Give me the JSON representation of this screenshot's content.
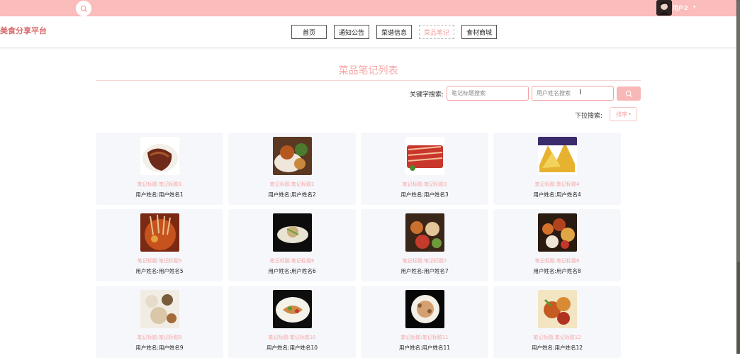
{
  "topbar": {
    "username": "用户2",
    "caret": "▾"
  },
  "brand": {
    "logo": "美食分享平台"
  },
  "nav": {
    "items": [
      {
        "label": "首页"
      },
      {
        "label": "通知公告"
      },
      {
        "label": "菜谱信息"
      },
      {
        "label": "菜品笔记"
      },
      {
        "label": "食材商城"
      }
    ],
    "active": "菜品笔记"
  },
  "main": {
    "title": "菜品笔记列表",
    "search": {
      "keyword_label": "关键字搜索:",
      "title_placeholder": "笔记标题搜索",
      "user_placeholder": "用户姓名搜索"
    },
    "dropdown": {
      "label": "下拉搜索:",
      "selected": "排序"
    }
  },
  "cards": [
    {
      "title": "笔记标题:笔记标题1",
      "user": "用户姓名:用户姓名1"
    },
    {
      "title": "笔记标题:笔记标题2",
      "user": "用户姓名:用户姓名2"
    },
    {
      "title": "笔记标题:笔记标题3",
      "user": "用户姓名:用户姓名3"
    },
    {
      "title": "笔记标题:笔记标题4",
      "user": "用户姓名:用户姓名4"
    },
    {
      "title": "笔记标题:笔记标题5",
      "user": "用户姓名:用户姓名5"
    },
    {
      "title": "笔记标题:笔记标题6",
      "user": "用户姓名:用户姓名6"
    },
    {
      "title": "笔记标题:笔记标题7",
      "user": "用户姓名:用户姓名7"
    },
    {
      "title": "笔记标题:笔记标题8",
      "user": "用户姓名:用户姓名8"
    },
    {
      "title": "笔记标题:笔记标题9",
      "user": "用户姓名:用户姓名9"
    },
    {
      "title": "笔记标题:笔记标题10",
      "user": "用户姓名:用户姓名10"
    },
    {
      "title": "笔记标题:笔记标题11",
      "user": "用户姓名:用户姓名11"
    },
    {
      "title": "笔记标题:笔记标题12",
      "user": "用户姓名:用户姓名12"
    }
  ],
  "colors": {
    "accent": "#fbbcbc",
    "title_pink": "#f7a7a7",
    "card_bg": "#f5f7fb"
  }
}
